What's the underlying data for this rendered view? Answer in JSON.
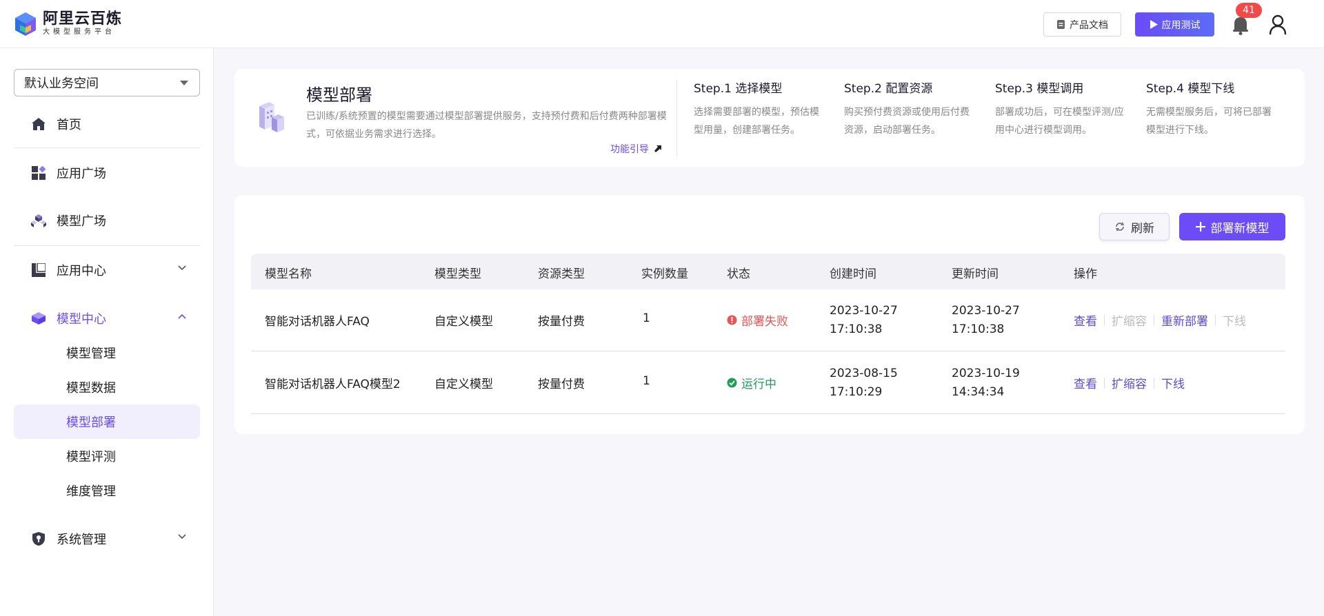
{
  "header": {
    "app_title": "阿里云百炼",
    "app_subtitle": "大模型服务平台",
    "doc_button": "产品文档",
    "test_button": "应用测试",
    "notification_count": "41"
  },
  "sidebar": {
    "workspace": "默认业务空间",
    "items": [
      {
        "label": "首页",
        "icon": "home-icon"
      },
      {
        "label": "应用广场",
        "icon": "grid-icon"
      },
      {
        "label": "模型广场",
        "icon": "cubes-icon"
      },
      {
        "label": "应用中心",
        "icon": "app-center-icon"
      },
      {
        "label": "模型中心",
        "icon": "model-center-icon"
      },
      {
        "label": "系统管理",
        "icon": "shield-icon"
      }
    ],
    "model_center_sub": [
      "模型管理",
      "模型数据",
      "模型部署",
      "模型评测",
      "维度管理"
    ]
  },
  "intro": {
    "title": "模型部署",
    "description": "已训练/系统预置的模型需要通过模型部署提供服务，支持预付费和后付费两种部署模式，可依据业务需求进行选择。",
    "guide_link": "功能引导",
    "steps": [
      {
        "title": "Step.1 选择模型",
        "desc": "选择需要部署的模型，预估模型用量，创建部署任务。"
      },
      {
        "title": "Step.2 配置资源",
        "desc": "购买预付费资源或使用后付费资源，启动部署任务。"
      },
      {
        "title": "Step.3 模型调用",
        "desc": "部署成功后，可在模型评测/应用中心进行模型调用。"
      },
      {
        "title": "Step.4 模型下线",
        "desc": "无需模型服务后，可将已部署模型进行下线。"
      }
    ]
  },
  "toolbar": {
    "refresh": "刷新",
    "deploy_new": "部署新模型"
  },
  "table": {
    "columns": [
      "模型名称",
      "模型类型",
      "资源类型",
      "实例数量",
      "状态",
      "创建时间",
      "更新时间",
      "操作"
    ],
    "rows": [
      {
        "name": "智能对话机器人FAQ",
        "type": "自定义模型",
        "resource": "按量付费",
        "instances": "1",
        "status": "部署失败",
        "created_date": "2023-10-27",
        "created_time": "17:10:38",
        "updated_date": "2023-10-27",
        "updated_time": "17:10:38",
        "actions": [
          "查看",
          "扩缩容",
          "重新部署",
          "下线"
        ]
      },
      {
        "name": "智能对话机器人FAQ模型2",
        "type": "自定义模型",
        "resource": "按量付费",
        "instances": "1",
        "status": "运行中",
        "created_date": "2023-08-15",
        "created_time": "17:10:29",
        "updated_date": "2023-10-19",
        "updated_time": "14:34:34",
        "actions": [
          "查看",
          "扩缩容",
          "下线"
        ]
      }
    ]
  },
  "colors": {
    "accent": "#6b4cf6",
    "fail": "#e85353",
    "ok": "#1f9d5a",
    "badge": "#f04a4a"
  }
}
